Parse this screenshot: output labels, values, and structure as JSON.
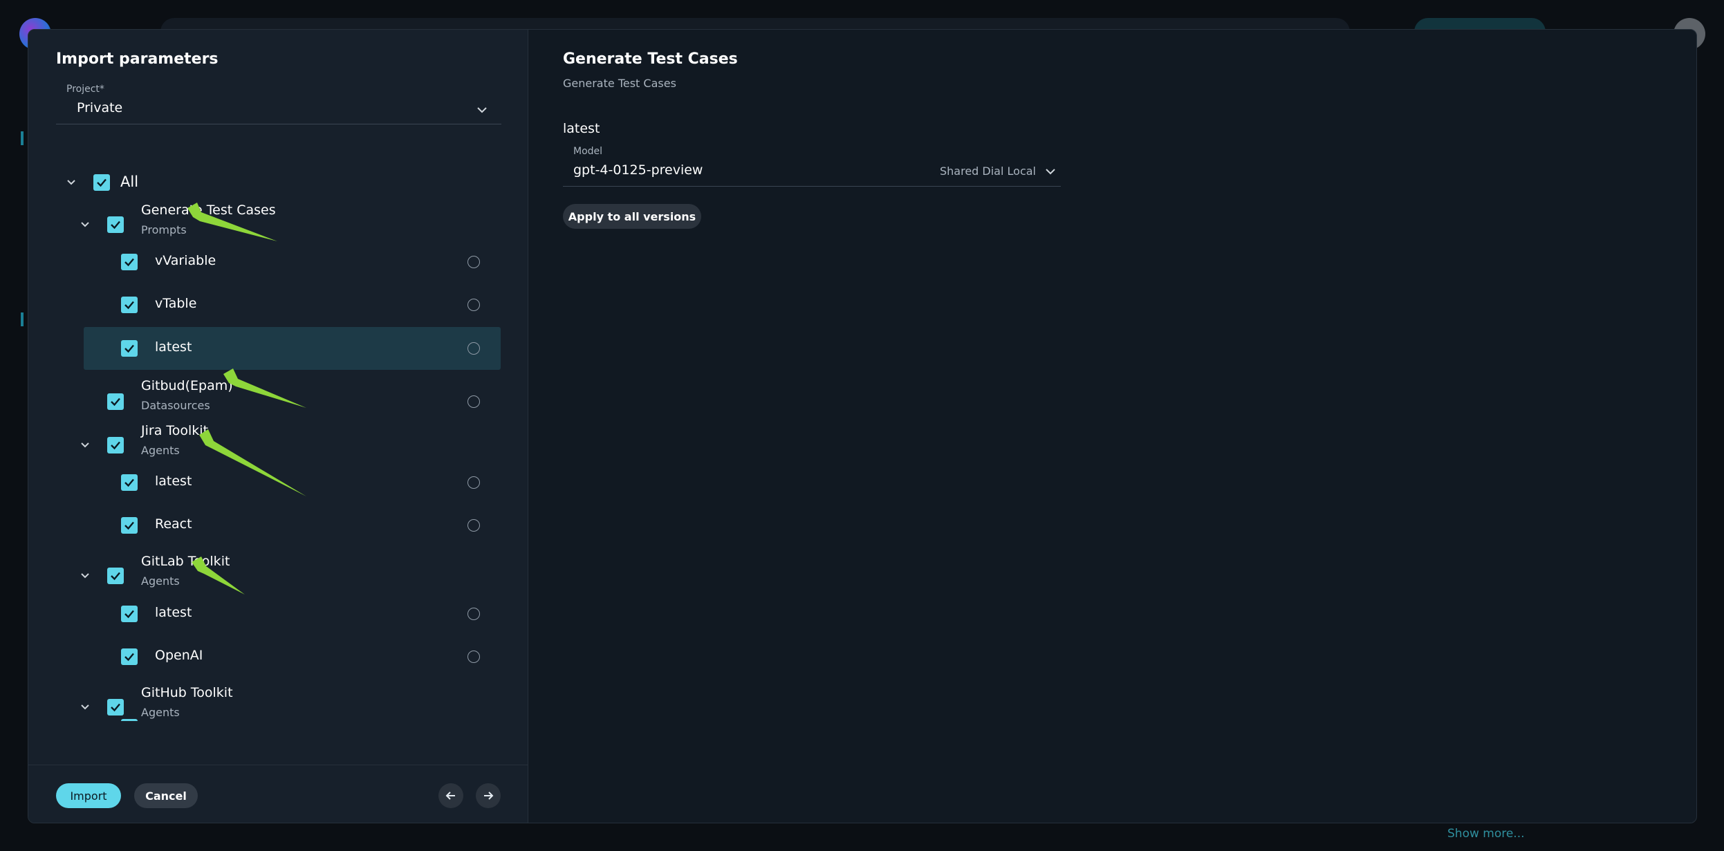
{
  "modal": {
    "title": "Import parameters",
    "project": {
      "label": "Project*",
      "value": "Private"
    },
    "tree": {
      "all_label": "All",
      "rows": [
        {
          "title": "Generate Test Cases",
          "subtitle": "Prompts"
        },
        {
          "title": "vVariable"
        },
        {
          "title": "vTable"
        },
        {
          "title": "latest"
        },
        {
          "title": "Gitbud(Epam)",
          "subtitle": "Datasources"
        },
        {
          "title": "Jira Toolkit",
          "subtitle": "Agents"
        },
        {
          "title": "latest"
        },
        {
          "title": "React"
        },
        {
          "title": "GitLab Toolkit",
          "subtitle": "Agents"
        },
        {
          "title": "latest"
        },
        {
          "title": "OpenAI"
        },
        {
          "title": "GitHub Toolkit",
          "subtitle": "Agents"
        }
      ]
    },
    "footer": {
      "import_label": "Import",
      "cancel_label": "Cancel"
    }
  },
  "details": {
    "title": "Generate Test Cases",
    "subtitle": "Generate Test Cases",
    "version": "latest",
    "model": {
      "label": "Model",
      "value": "gpt-4-0125-preview",
      "provider": "Shared Dial Local"
    },
    "apply_label": "Apply to all versions"
  },
  "background": {
    "show_more": "Show more..."
  },
  "colors": {
    "accent": "#5fd6ea",
    "annotation_arrow": "#8ed63a",
    "panel": "#17202b",
    "surface": "#111922"
  }
}
